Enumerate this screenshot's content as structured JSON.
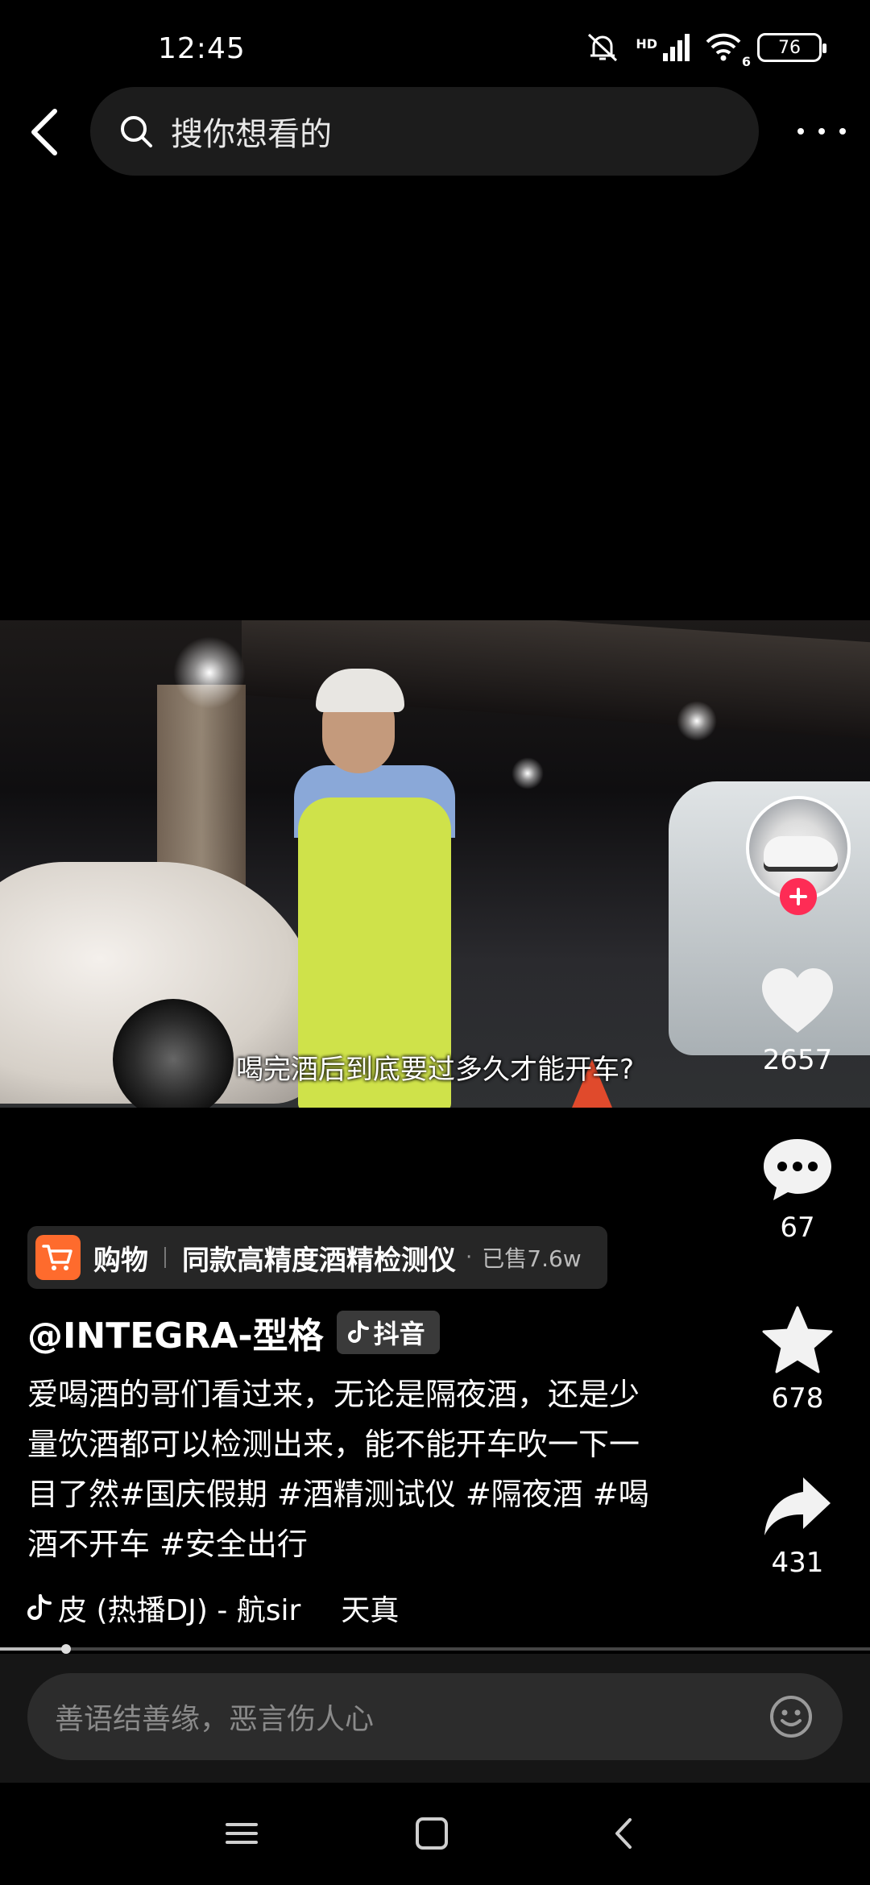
{
  "status_bar": {
    "time": "12:45",
    "network": "HD",
    "wifi_label": "6",
    "battery": "76"
  },
  "header": {
    "search_placeholder": "搜你想看的"
  },
  "video": {
    "subtitle": "喝完酒后到底要过多久才能开车?"
  },
  "actions": {
    "likes": "2657",
    "comments": "67",
    "favorites": "678",
    "shares": "431"
  },
  "shop": {
    "label": "购物",
    "title": "同款高精度酒精检测仪",
    "dot": "·",
    "sold": "已售7.6w"
  },
  "author": {
    "name": "@INTEGRA-型格",
    "badge": "抖音"
  },
  "description": "爱喝酒的哥们看过来，无论是隔夜酒，还是少量饮酒都可以检测出来，能不能开车吹一下一目了然#国庆假期 #酒精测试仪 #隔夜酒 #喝酒不开车 #安全出行",
  "music": {
    "text": "皮 (热播DJ) - 航sir",
    "text2": "天真"
  },
  "playback": {
    "progress": 0.076
  },
  "comment_bar": {
    "placeholder": "善语结善缘，恶言伤人心"
  },
  "colors": {
    "accent": "#fe2c55",
    "shop": "#fe6b2d",
    "background": "#000000"
  },
  "icons": [
    "back-arrow-icon",
    "search-icon",
    "more-icon",
    "heart-icon",
    "comment-icon",
    "star-icon",
    "share-icon",
    "cart-icon",
    "tiktok-icon",
    "emoji-icon",
    "menu-icon",
    "home-icon",
    "back-icon"
  ]
}
